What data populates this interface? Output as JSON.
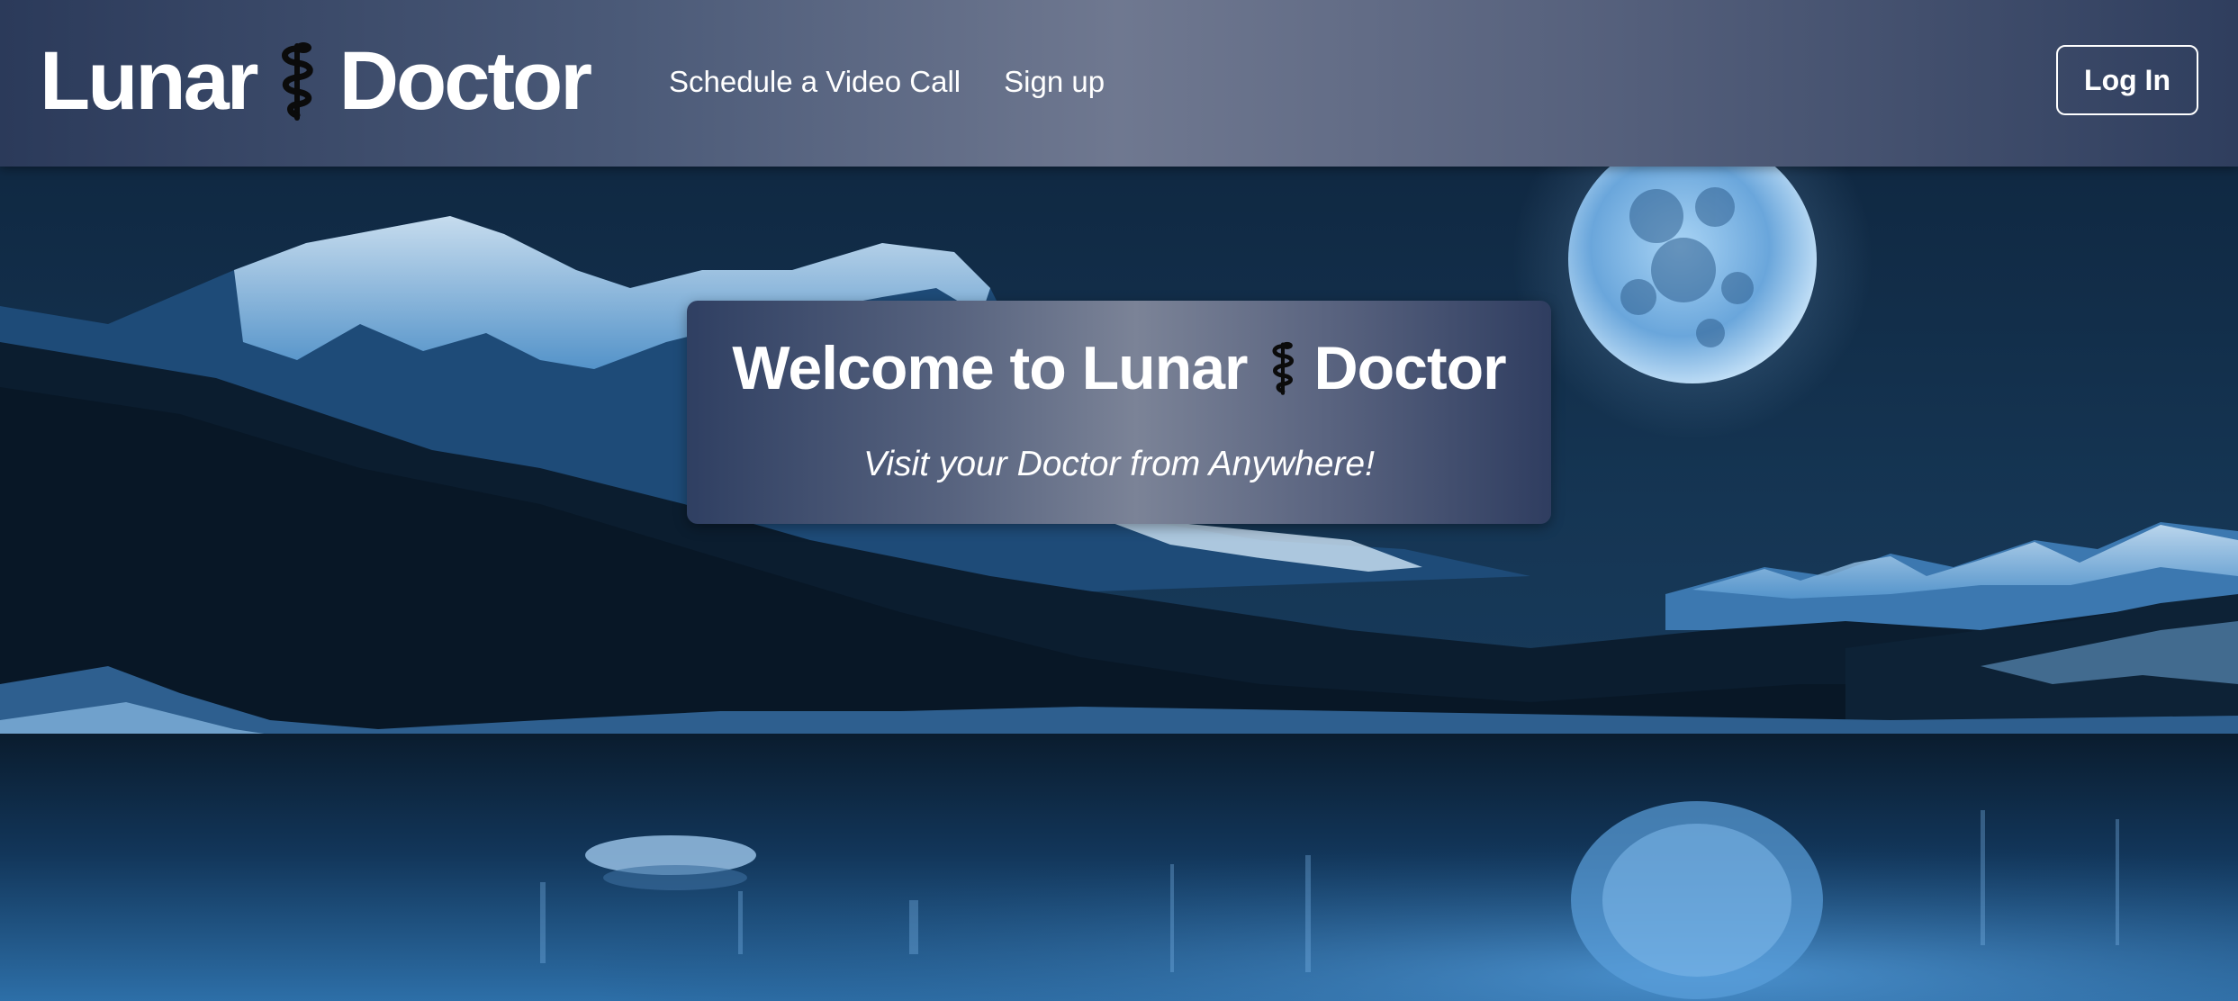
{
  "navbar": {
    "brand_left": "Lunar",
    "brand_right": "Doctor",
    "links": [
      {
        "label": "Schedule a Video Call"
      },
      {
        "label": "Sign up"
      }
    ],
    "login_label": "Log In"
  },
  "hero": {
    "title_left": "Welcome to Lunar",
    "title_right": "Doctor",
    "subtitle": "Visit your Doctor from Anywhere!"
  },
  "icons": {
    "brand_logo": "caduceus-icon",
    "title_logo": "caduceus-icon"
  },
  "colors": {
    "navbar_gradient_mid": "#6f7890",
    "navbar_gradient_edge": "#2b3a5a",
    "text": "#ffffff",
    "night_sky": "#0f2a45",
    "moon": "#7fb6e6"
  }
}
